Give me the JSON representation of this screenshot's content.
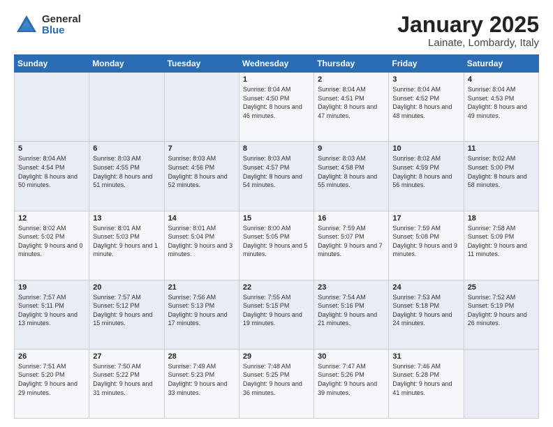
{
  "logo": {
    "general": "General",
    "blue": "Blue"
  },
  "header": {
    "month_year": "January 2025",
    "location": "Lainate, Lombardy, Italy"
  },
  "weekdays": [
    "Sunday",
    "Monday",
    "Tuesday",
    "Wednesday",
    "Thursday",
    "Friday",
    "Saturday"
  ],
  "weeks": [
    [
      {
        "day": "",
        "info": ""
      },
      {
        "day": "",
        "info": ""
      },
      {
        "day": "",
        "info": ""
      },
      {
        "day": "1",
        "info": "Sunrise: 8:04 AM\nSunset: 4:50 PM\nDaylight: 8 hours\nand 46 minutes."
      },
      {
        "day": "2",
        "info": "Sunrise: 8:04 AM\nSunset: 4:51 PM\nDaylight: 8 hours\nand 47 minutes."
      },
      {
        "day": "3",
        "info": "Sunrise: 8:04 AM\nSunset: 4:52 PM\nDaylight: 8 hours\nand 48 minutes."
      },
      {
        "day": "4",
        "info": "Sunrise: 8:04 AM\nSunset: 4:53 PM\nDaylight: 8 hours\nand 49 minutes."
      }
    ],
    [
      {
        "day": "5",
        "info": "Sunrise: 8:04 AM\nSunset: 4:54 PM\nDaylight: 8 hours\nand 50 minutes."
      },
      {
        "day": "6",
        "info": "Sunrise: 8:03 AM\nSunset: 4:55 PM\nDaylight: 8 hours\nand 51 minutes."
      },
      {
        "day": "7",
        "info": "Sunrise: 8:03 AM\nSunset: 4:56 PM\nDaylight: 8 hours\nand 52 minutes."
      },
      {
        "day": "8",
        "info": "Sunrise: 8:03 AM\nSunset: 4:57 PM\nDaylight: 8 hours\nand 54 minutes."
      },
      {
        "day": "9",
        "info": "Sunrise: 8:03 AM\nSunset: 4:58 PM\nDaylight: 8 hours\nand 55 minutes."
      },
      {
        "day": "10",
        "info": "Sunrise: 8:02 AM\nSunset: 4:59 PM\nDaylight: 8 hours\nand 56 minutes."
      },
      {
        "day": "11",
        "info": "Sunrise: 8:02 AM\nSunset: 5:00 PM\nDaylight: 8 hours\nand 58 minutes."
      }
    ],
    [
      {
        "day": "12",
        "info": "Sunrise: 8:02 AM\nSunset: 5:02 PM\nDaylight: 9 hours\nand 0 minutes."
      },
      {
        "day": "13",
        "info": "Sunrise: 8:01 AM\nSunset: 5:03 PM\nDaylight: 9 hours\nand 1 minute."
      },
      {
        "day": "14",
        "info": "Sunrise: 8:01 AM\nSunset: 5:04 PM\nDaylight: 9 hours\nand 3 minutes."
      },
      {
        "day": "15",
        "info": "Sunrise: 8:00 AM\nSunset: 5:05 PM\nDaylight: 9 hours\nand 5 minutes."
      },
      {
        "day": "16",
        "info": "Sunrise: 7:59 AM\nSunset: 5:07 PM\nDaylight: 9 hours\nand 7 minutes."
      },
      {
        "day": "17",
        "info": "Sunrise: 7:59 AM\nSunset: 5:08 PM\nDaylight: 9 hours\nand 9 minutes."
      },
      {
        "day": "18",
        "info": "Sunrise: 7:58 AM\nSunset: 5:09 PM\nDaylight: 9 hours\nand 11 minutes."
      }
    ],
    [
      {
        "day": "19",
        "info": "Sunrise: 7:57 AM\nSunset: 5:11 PM\nDaylight: 9 hours\nand 13 minutes."
      },
      {
        "day": "20",
        "info": "Sunrise: 7:57 AM\nSunset: 5:12 PM\nDaylight: 9 hours\nand 15 minutes."
      },
      {
        "day": "21",
        "info": "Sunrise: 7:56 AM\nSunset: 5:13 PM\nDaylight: 9 hours\nand 17 minutes."
      },
      {
        "day": "22",
        "info": "Sunrise: 7:55 AM\nSunset: 5:15 PM\nDaylight: 9 hours\nand 19 minutes."
      },
      {
        "day": "23",
        "info": "Sunrise: 7:54 AM\nSunset: 5:16 PM\nDaylight: 9 hours\nand 21 minutes."
      },
      {
        "day": "24",
        "info": "Sunrise: 7:53 AM\nSunset: 5:18 PM\nDaylight: 9 hours\nand 24 minutes."
      },
      {
        "day": "25",
        "info": "Sunrise: 7:52 AM\nSunset: 5:19 PM\nDaylight: 9 hours\nand 26 minutes."
      }
    ],
    [
      {
        "day": "26",
        "info": "Sunrise: 7:51 AM\nSunset: 5:20 PM\nDaylight: 9 hours\nand 29 minutes."
      },
      {
        "day": "27",
        "info": "Sunrise: 7:50 AM\nSunset: 5:22 PM\nDaylight: 9 hours\nand 31 minutes."
      },
      {
        "day": "28",
        "info": "Sunrise: 7:49 AM\nSunset: 5:23 PM\nDaylight: 9 hours\nand 33 minutes."
      },
      {
        "day": "29",
        "info": "Sunrise: 7:48 AM\nSunset: 5:25 PM\nDaylight: 9 hours\nand 36 minutes."
      },
      {
        "day": "30",
        "info": "Sunrise: 7:47 AM\nSunset: 5:26 PM\nDaylight: 9 hours\nand 39 minutes."
      },
      {
        "day": "31",
        "info": "Sunrise: 7:46 AM\nSunset: 5:28 PM\nDaylight: 9 hours\nand 41 minutes."
      },
      {
        "day": "",
        "info": ""
      }
    ]
  ]
}
